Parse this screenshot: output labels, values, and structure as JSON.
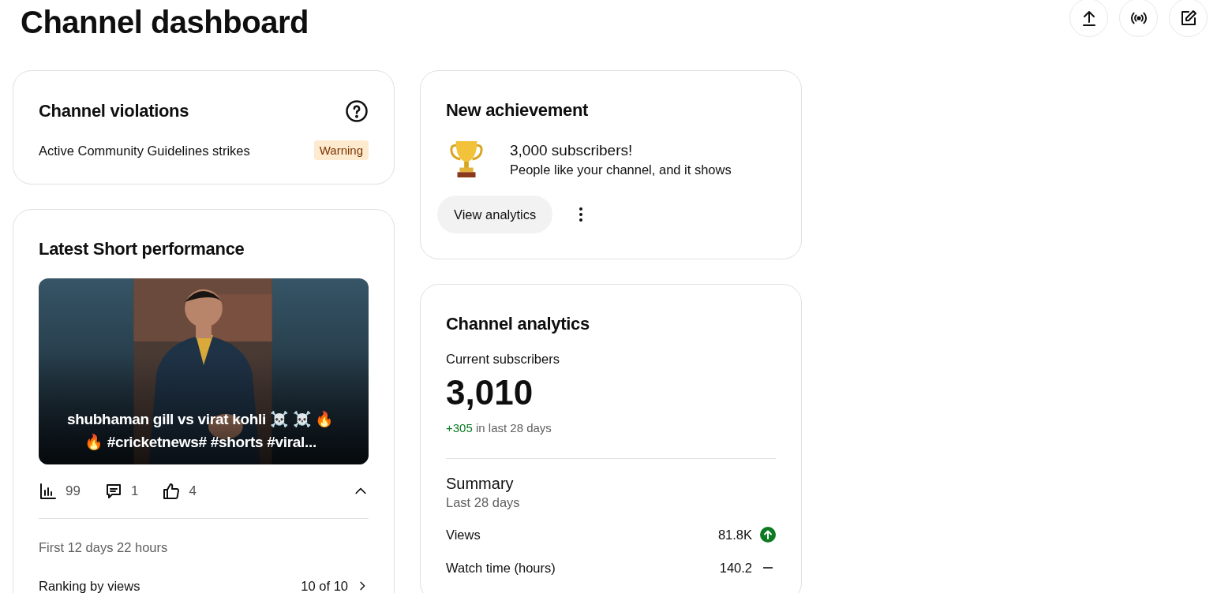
{
  "page_title": "Channel dashboard",
  "header_actions": [
    {
      "kind": "upload"
    },
    {
      "kind": "live"
    },
    {
      "kind": "edit"
    }
  ],
  "violations": {
    "title": "Channel violations",
    "label": "Active Community Guidelines strikes",
    "badge": "Warning"
  },
  "short": {
    "title": "Latest Short performance",
    "thumbnail": {
      "kind": "picture",
      "caption": "shubhaman gill vs virat kohli ☠️ ☠️ 🔥 🔥  #cricketnews# #shorts #viral..."
    },
    "stats": [
      {
        "kind": "views",
        "value": "99"
      },
      {
        "kind": "comments",
        "value": "1"
      },
      {
        "kind": "likes",
        "value": "4"
      }
    ],
    "expanded": true,
    "period": "First 12 days 22 hours",
    "ranking_label": "Ranking by views",
    "ranking_value": "10 of 10"
  },
  "achievement": {
    "title": "New achievement",
    "headline": "3,000 subscribers!",
    "text": "People like your channel, and it shows",
    "button": "View analytics"
  },
  "analytics": {
    "title": "Channel analytics",
    "subscribers_label": "Current subscribers",
    "subscribers": "3,010",
    "change": "+305",
    "change_suffix": " in last 28 days",
    "summary_title": "Summary",
    "summary_period": "Last 28 days",
    "metrics": [
      {
        "label": "Views",
        "value": "81.8K",
        "kind": "up"
      },
      {
        "label": "Watch time (hours)",
        "value": "140.2",
        "kind": "flat"
      }
    ]
  }
}
